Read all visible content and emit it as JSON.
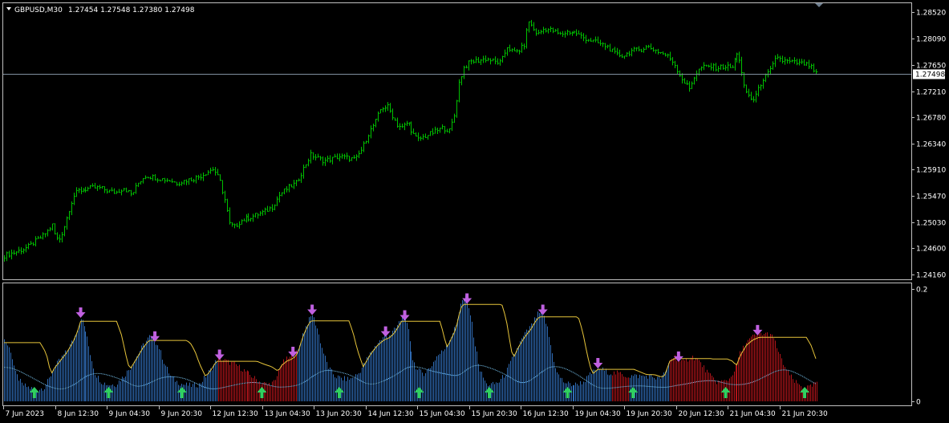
{
  "header": {
    "symbol_timeframe": "GBPUSD,M30",
    "ohlc": "1.27454 1.27548 1.27380 1.27498"
  },
  "colors": {
    "background": "#000000",
    "frame": "#c0c0c0",
    "bar_up": "#00c000",
    "current_price_line": "#7f8fa0",
    "hist_blue": "#2f6bb5",
    "hist_red": "#b0141a",
    "line_yellow": "#e6c43a",
    "line_cyan": "#7fd0ff",
    "arrow_down": "#c060e0",
    "arrow_up": "#30d060",
    "text": "#ffffff"
  },
  "chart_data": [
    {
      "type": "bar",
      "name_shown": "GBPUSD,M30",
      "y_ticks": [
        "1.28520",
        "1.28090",
        "1.27650",
        "1.27210",
        "1.26780",
        "1.26340",
        "1.25910",
        "1.25470",
        "1.25030",
        "1.24600",
        "1.24160"
      ],
      "y_tick_values": [
        1.2852,
        1.2809,
        1.2765,
        1.2721,
        1.2678,
        1.2634,
        1.2591,
        1.2547,
        1.2503,
        1.246,
        1.2416
      ],
      "ylim": [
        1.2409,
        1.2866
      ],
      "current_price": 1.27498,
      "current_price_label": "1.27498",
      "x_ticks": [
        "7 Jun 2023",
        "8 Jun 12:30",
        "9 Jun 04:30",
        "9 Jun 20:30",
        "12 Jun 12:30",
        "13 Jun 04:30",
        "13 Jun 20:30",
        "14 Jun 12:30",
        "15 Jun 04:30",
        "15 Jun 20:30",
        "16 Jun 12:30",
        "19 Jun 04:30",
        "19 Jun 20:30",
        "20 Jun 12:30",
        "21 Jun 04:30",
        "21 Jun 20:30"
      ],
      "close_series": [
        [
          0,
          1.2447
        ],
        [
          6,
          1.245
        ],
        [
          12,
          1.2452
        ],
        [
          18,
          1.2455
        ],
        [
          24,
          1.2458
        ],
        [
          30,
          1.2462
        ],
        [
          36,
          1.2468
        ],
        [
          42,
          1.2474
        ],
        [
          48,
          1.248
        ],
        [
          54,
          1.2488
        ],
        [
          60,
          1.2498
        ],
        [
          64,
          1.2478
        ],
        [
          68,
          1.2472
        ],
        [
          72,
          1.2485
        ],
        [
          76,
          1.25
        ],
        [
          80,
          1.252
        ],
        [
          86,
          1.2545
        ],
        [
          92,
          1.2555
        ],
        [
          100,
          1.2557
        ],
        [
          110,
          1.256
        ],
        [
          120,
          1.256
        ],
        [
          130,
          1.2555
        ],
        [
          140,
          1.2552
        ],
        [
          150,
          1.256
        ],
        [
          160,
          1.2548
        ],
        [
          168,
          1.2568
        ],
        [
          176,
          1.258
        ],
        [
          186,
          1.2578
        ],
        [
          196,
          1.2575
        ],
        [
          206,
          1.2573
        ],
        [
          216,
          1.2568
        ],
        [
          226,
          1.2572
        ],
        [
          236,
          1.2575
        ],
        [
          246,
          1.258
        ],
        [
          256,
          1.2588
        ],
        [
          262,
          1.2592
        ],
        [
          270,
          1.257
        ],
        [
          276,
          1.254
        ],
        [
          282,
          1.25
        ],
        [
          288,
          1.2495
        ],
        [
          296,
          1.2505
        ],
        [
          306,
          1.251
        ],
        [
          316,
          1.2515
        ],
        [
          326,
          1.252
        ],
        [
          336,
          1.2528
        ],
        [
          346,
          1.255
        ],
        [
          356,
          1.256
        ],
        [
          366,
          1.2568
        ],
        [
          376,
          1.2595
        ],
        [
          384,
          1.2615
        ],
        [
          392,
          1.261
        ],
        [
          400,
          1.2605
        ],
        [
          410,
          1.2608
        ],
        [
          420,
          1.2612
        ],
        [
          430,
          1.261
        ],
        [
          440,
          1.2607
        ],
        [
          448,
          1.2625
        ],
        [
          456,
          1.265
        ],
        [
          464,
          1.2668
        ],
        [
          472,
          1.2693
        ],
        [
          480,
          1.2695
        ],
        [
          486,
          1.268
        ],
        [
          492,
          1.2665
        ],
        [
          498,
          1.266
        ],
        [
          506,
          1.267
        ],
        [
          512,
          1.265
        ],
        [
          518,
          1.264
        ],
        [
          526,
          1.2645
        ],
        [
          534,
          1.265
        ],
        [
          542,
          1.2655
        ],
        [
          550,
          1.266
        ],
        [
          558,
          1.2655
        ],
        [
          564,
          1.268
        ],
        [
          570,
          1.2735
        ],
        [
          576,
          1.276
        ],
        [
          584,
          1.277
        ],
        [
          594,
          1.2772
        ],
        [
          604,
          1.2775
        ],
        [
          614,
          1.277
        ],
        [
          622,
          1.2768
        ],
        [
          630,
          1.2795
        ],
        [
          638,
          1.2785
        ],
        [
          646,
          1.279
        ],
        [
          652,
          1.28
        ],
        [
          656,
          1.284
        ],
        [
          662,
          1.2825
        ],
        [
          668,
          1.2815
        ],
        [
          676,
          1.2825
        ],
        [
          686,
          1.2822
        ],
        [
          696,
          1.2815
        ],
        [
          706,
          1.282
        ],
        [
          716,
          1.2818
        ],
        [
          726,
          1.281
        ],
        [
          736,
          1.2805
        ],
        [
          746,
          1.28
        ],
        [
          756,
          1.2795
        ],
        [
          766,
          1.2782
        ],
        [
          776,
          1.278
        ],
        [
          786,
          1.2788
        ],
        [
          796,
          1.279
        ],
        [
          806,
          1.2795
        ],
        [
          814,
          1.279
        ],
        [
          822,
          1.2785
        ],
        [
          830,
          1.278
        ],
        [
          838,
          1.277
        ],
        [
          846,
          1.2748
        ],
        [
          852,
          1.2735
        ],
        [
          858,
          1.2725
        ],
        [
          864,
          1.2745
        ],
        [
          872,
          1.276
        ],
        [
          882,
          1.2762
        ],
        [
          892,
          1.276
        ],
        [
          902,
          1.2762
        ],
        [
          912,
          1.276
        ],
        [
          918,
          1.2785
        ],
        [
          922,
          1.277
        ],
        [
          926,
          1.273
        ],
        [
          932,
          1.2715
        ],
        [
          938,
          1.2705
        ],
        [
          944,
          1.272
        ],
        [
          950,
          1.274
        ],
        [
          956,
          1.2748
        ],
        [
          962,
          1.276
        ],
        [
          968,
          1.278
        ],
        [
          974,
          1.2772
        ],
        [
          982,
          1.277
        ],
        [
          992,
          1.2768
        ],
        [
          1002,
          1.2766
        ],
        [
          1010,
          1.2762
        ],
        [
          1016,
          1.275
        ],
        [
          1019,
          1.27498
        ]
      ]
    },
    {
      "type": "bar",
      "subtype": "histogram-indicator",
      "y_ticks": [
        "0.2",
        "0"
      ],
      "y_tick_values": [
        0.2,
        0
      ],
      "ylim": [
        0,
        0.2
      ],
      "hist_series": [
        [
          0,
          0.11
        ],
        [
          8,
          0.09
        ],
        [
          14,
          0.05
        ],
        [
          22,
          0.03
        ],
        [
          30,
          0.025
        ],
        [
          40,
          0.02
        ],
        [
          50,
          0.025
        ],
        [
          56,
          0.04
        ],
        [
          62,
          0.06
        ],
        [
          70,
          0.075
        ],
        [
          78,
          0.09
        ],
        [
          86,
          0.11
        ],
        [
          92,
          0.13
        ],
        [
          96,
          0.15
        ],
        [
          102,
          0.125
        ],
        [
          108,
          0.085
        ],
        [
          114,
          0.05
        ],
        [
          122,
          0.035
        ],
        [
          130,
          0.03
        ],
        [
          140,
          0.03
        ],
        [
          150,
          0.045
        ],
        [
          158,
          0.06
        ],
        [
          166,
          0.08
        ],
        [
          174,
          0.1
        ],
        [
          182,
          0.115
        ],
        [
          188,
          0.11
        ],
        [
          194,
          0.095
        ],
        [
          200,
          0.07
        ],
        [
          208,
          0.045
        ],
        [
          216,
          0.035
        ],
        [
          224,
          0.03
        ],
        [
          234,
          0.028
        ],
        [
          244,
          0.03
        ],
        [
          252,
          0.045
        ],
        [
          260,
          0.06
        ],
        [
          266,
          0.075
        ],
        [
          272,
          0.075
        ],
        [
          280,
          0.07
        ],
        [
          290,
          0.065
        ],
        [
          300,
          0.055
        ],
        [
          310,
          0.045
        ],
        [
          320,
          0.035
        ],
        [
          330,
          0.03
        ],
        [
          340,
          0.035
        ],
        [
          346,
          0.065
        ],
        [
          354,
          0.075
        ],
        [
          362,
          0.08
        ],
        [
          368,
          0.09
        ],
        [
          374,
          0.12
        ],
        [
          380,
          0.14
        ],
        [
          386,
          0.155
        ],
        [
          392,
          0.13
        ],
        [
          398,
          0.095
        ],
        [
          406,
          0.06
        ],
        [
          414,
          0.045
        ],
        [
          424,
          0.04
        ],
        [
          434,
          0.04
        ],
        [
          444,
          0.05
        ],
        [
          452,
          0.07
        ],
        [
          460,
          0.09
        ],
        [
          468,
          0.105
        ],
        [
          476,
          0.115
        ],
        [
          484,
          0.12
        ],
        [
          490,
          0.13
        ],
        [
          496,
          0.145
        ],
        [
          500,
          0.155
        ],
        [
          506,
          0.125
        ],
        [
          512,
          0.075
        ],
        [
          518,
          0.055
        ],
        [
          526,
          0.05
        ],
        [
          534,
          0.06
        ],
        [
          542,
          0.08
        ],
        [
          550,
          0.09
        ],
        [
          558,
          0.11
        ],
        [
          566,
          0.135
        ],
        [
          572,
          0.175
        ],
        [
          578,
          0.185
        ],
        [
          584,
          0.155
        ],
        [
          590,
          0.1
        ],
        [
          596,
          0.055
        ],
        [
          604,
          0.03
        ],
        [
          612,
          0.03
        ],
        [
          620,
          0.035
        ],
        [
          628,
          0.05
        ],
        [
          636,
          0.075
        ],
        [
          644,
          0.1
        ],
        [
          652,
          0.12
        ],
        [
          660,
          0.135
        ],
        [
          668,
          0.155
        ],
        [
          674,
          0.16
        ],
        [
          680,
          0.13
        ],
        [
          686,
          0.085
        ],
        [
          692,
          0.05
        ],
        [
          700,
          0.035
        ],
        [
          708,
          0.03
        ],
        [
          716,
          0.03
        ],
        [
          726,
          0.035
        ],
        [
          736,
          0.05
        ],
        [
          744,
          0.06
        ],
        [
          752,
          0.055
        ],
        [
          760,
          0.05
        ],
        [
          770,
          0.05
        ],
        [
          780,
          0.045
        ],
        [
          790,
          0.045
        ],
        [
          800,
          0.045
        ],
        [
          810,
          0.045
        ],
        [
          820,
          0.04
        ],
        [
          828,
          0.05
        ],
        [
          834,
          0.075
        ],
        [
          840,
          0.08
        ],
        [
          846,
          0.07
        ],
        [
          852,
          0.07
        ],
        [
          860,
          0.08
        ],
        [
          868,
          0.075
        ],
        [
          876,
          0.06
        ],
        [
          884,
          0.045
        ],
        [
          892,
          0.035
        ],
        [
          900,
          0.035
        ],
        [
          908,
          0.04
        ],
        [
          916,
          0.06
        ],
        [
          922,
          0.085
        ],
        [
          930,
          0.105
        ],
        [
          938,
          0.115
        ],
        [
          946,
          0.12
        ],
        [
          952,
          0.12
        ],
        [
          960,
          0.12
        ],
        [
          966,
          0.105
        ],
        [
          972,
          0.08
        ],
        [
          980,
          0.055
        ],
        [
          990,
          0.035
        ],
        [
          1000,
          0.025
        ],
        [
          1010,
          0.025
        ],
        [
          1018,
          0.035
        ]
      ],
      "red_ranges": [
        [
          268,
          366
        ],
        [
          762,
          782
        ],
        [
          833,
          920
        ],
        [
          920,
          1019
        ]
      ],
      "down_arrows": [
        96,
        189,
        270,
        362,
        386,
        478,
        502,
        580,
        675,
        744,
        845,
        944
      ],
      "up_arrows": [
        38,
        131,
        223,
        323,
        420,
        520,
        608,
        706,
        788,
        904,
        1003
      ]
    }
  ]
}
